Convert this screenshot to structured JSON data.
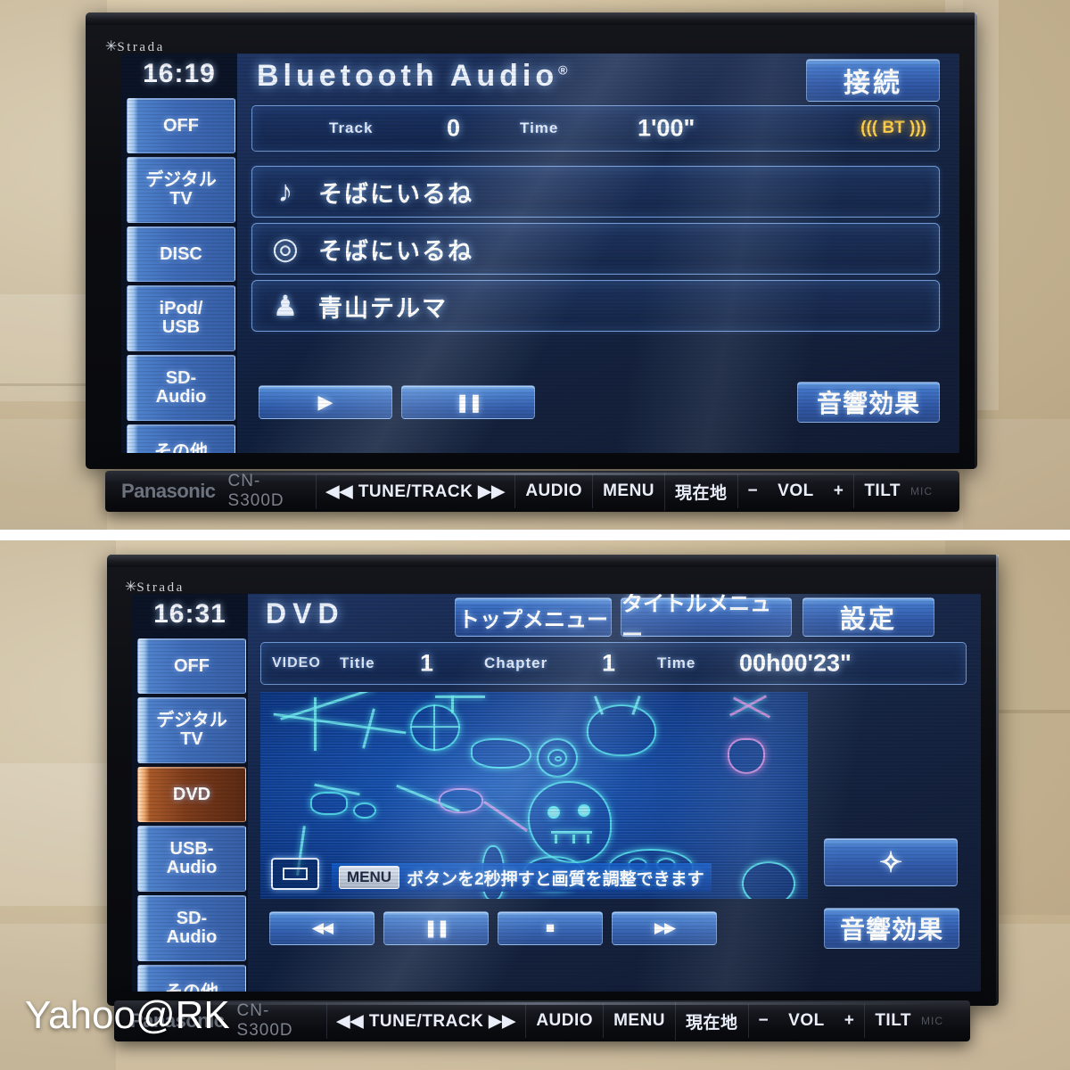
{
  "device": {
    "brand": "Panasonic",
    "model": "CN-S300D",
    "logo": "Strada",
    "logo_star": "✳"
  },
  "hardware_buttons": [
    {
      "label": "TUNE/TRACK",
      "prefix": "◀◀",
      "suffix": "▶▶"
    },
    {
      "label": "AUDIO"
    },
    {
      "label": "MENU"
    },
    {
      "label": "現在地"
    },
    {
      "label": "−"
    },
    {
      "label": "VOL"
    },
    {
      "label": "+"
    },
    {
      "label": "TILT"
    }
  ],
  "mic_label": "MIC",
  "watermark": "Yahoo@RK",
  "panels": [
    {
      "id": "bluetooth-audio",
      "clock": "16:19",
      "screen_title": "Bluetooth Audio",
      "screen_title_sup": "®",
      "header_button": "接続",
      "sources": [
        {
          "label": "OFF",
          "active": false
        },
        {
          "label": "デジタル",
          "label2": "TV",
          "active": false
        },
        {
          "label": "DISC",
          "active": false
        },
        {
          "label": "iPod/",
          "label2": "USB",
          "active": false
        },
        {
          "label": "SD-",
          "label2": "Audio",
          "active": false
        },
        {
          "label": "その他",
          "active": false
        }
      ],
      "info": {
        "track_label": "Track",
        "track_value": "0",
        "time_label": "Time",
        "time_value": "1'00\"",
        "bt_indicator": "((( BT )))"
      },
      "metadata_rows": [
        {
          "icon": "music-note-icon",
          "glyph": "♪",
          "text": "そばにいるね"
        },
        {
          "icon": "disc-icon",
          "glyph": "◎",
          "text": "そばにいるね"
        },
        {
          "icon": "artist-icon",
          "glyph": "♟",
          "text": "青山テルマ"
        }
      ],
      "transport": [
        {
          "name": "play-button",
          "glyph": "▶"
        },
        {
          "name": "pause-button",
          "glyph": "❚❚"
        }
      ],
      "sound_effect_button": "音響効果"
    },
    {
      "id": "dvd",
      "clock": "16:31",
      "screen_title": "DVD",
      "header_buttons": [
        {
          "name": "top-menu-button",
          "label": "トップメニュー"
        },
        {
          "name": "title-menu-button",
          "label": "タイトルメニュー"
        },
        {
          "name": "settings-button",
          "label": "設定"
        }
      ],
      "sources": [
        {
          "label": "OFF",
          "active": false
        },
        {
          "label": "デジタル",
          "label2": "TV",
          "active": false
        },
        {
          "label": "DVD",
          "active": true
        },
        {
          "label": "USB-",
          "label2": "Audio",
          "active": false
        },
        {
          "label": "SD-",
          "label2": "Audio",
          "active": false
        },
        {
          "label": "その他",
          "active": false
        }
      ],
      "info": {
        "mode_label": "VIDEO",
        "title_label": "Title",
        "title_value": "1",
        "chapter_label": "Chapter",
        "chapter_value": "1",
        "time_label": "Time",
        "time_value": "00h00'23\""
      },
      "caption": {
        "key": "MENU",
        "text": "ボタンを2秒押すと画質を調整できます"
      },
      "transport": [
        {
          "name": "rewind-button",
          "glyph": "◀◀"
        },
        {
          "name": "pause-button",
          "glyph": "❚❚"
        },
        {
          "name": "stop-button",
          "glyph": "■"
        },
        {
          "name": "fast-forward-button",
          "glyph": "▶▶"
        }
      ],
      "direction_pad_glyph": "✧",
      "sound_effect_button": "音響効果"
    }
  ],
  "colors": {
    "lcd_blue": "#16284d",
    "button_blue": "#3d72c6",
    "active_orange": "#a95a2a",
    "bt_gold": "#ffcf45",
    "video_cyan": "#5af5ff"
  }
}
